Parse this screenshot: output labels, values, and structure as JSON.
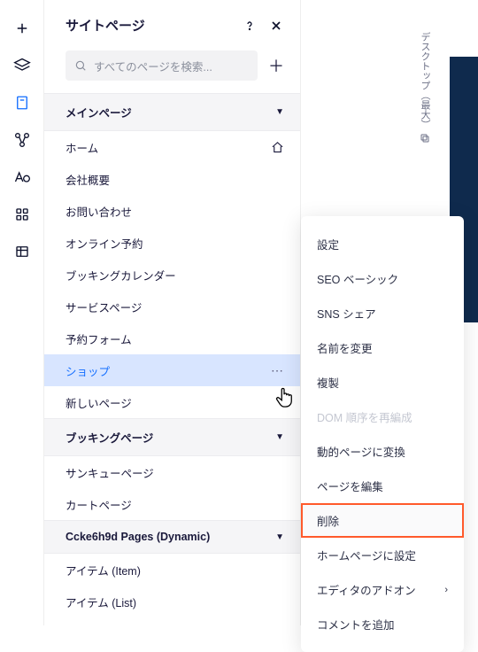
{
  "panel": {
    "title": "サイトページ",
    "search_placeholder": "すべてのページを検索..."
  },
  "sections": [
    {
      "title": "メインページ",
      "items": [
        {
          "label": "ホーム",
          "home": true
        },
        {
          "label": "会社概要"
        },
        {
          "label": "お問い合わせ"
        },
        {
          "label": "オンライン予約"
        },
        {
          "label": "ブッキングカレンダー"
        },
        {
          "label": "サービスページ"
        },
        {
          "label": "予約フォーム"
        },
        {
          "label": "ショップ",
          "selected": true,
          "dots": true
        },
        {
          "label": "新しいページ"
        }
      ]
    },
    {
      "title": "ブッキングページ",
      "items": [
        {
          "label": "サンキューページ"
        },
        {
          "label": "カートページ"
        }
      ]
    },
    {
      "title": "Ccke6h9d Pages (Dynamic)",
      "items": [
        {
          "label": "アイテム (Item)"
        },
        {
          "label": "アイテム (List)"
        }
      ]
    }
  ],
  "context_menu": [
    {
      "label": "設定"
    },
    {
      "label": "SEO ベーシック"
    },
    {
      "label": "SNS シェア"
    },
    {
      "label": "名前を変更"
    },
    {
      "label": "複製"
    },
    {
      "label": "DOM 順序を再編成",
      "disabled": true
    },
    {
      "label": "動的ページに変換"
    },
    {
      "label": "ページを編集"
    },
    {
      "label": "削除",
      "highlight": true
    },
    {
      "label": "ホームページに設定"
    },
    {
      "label": "エディタのアドオン",
      "arrow": true
    },
    {
      "label": "コメントを追加"
    }
  ],
  "viewport_label": "デスクトップ（最大）"
}
